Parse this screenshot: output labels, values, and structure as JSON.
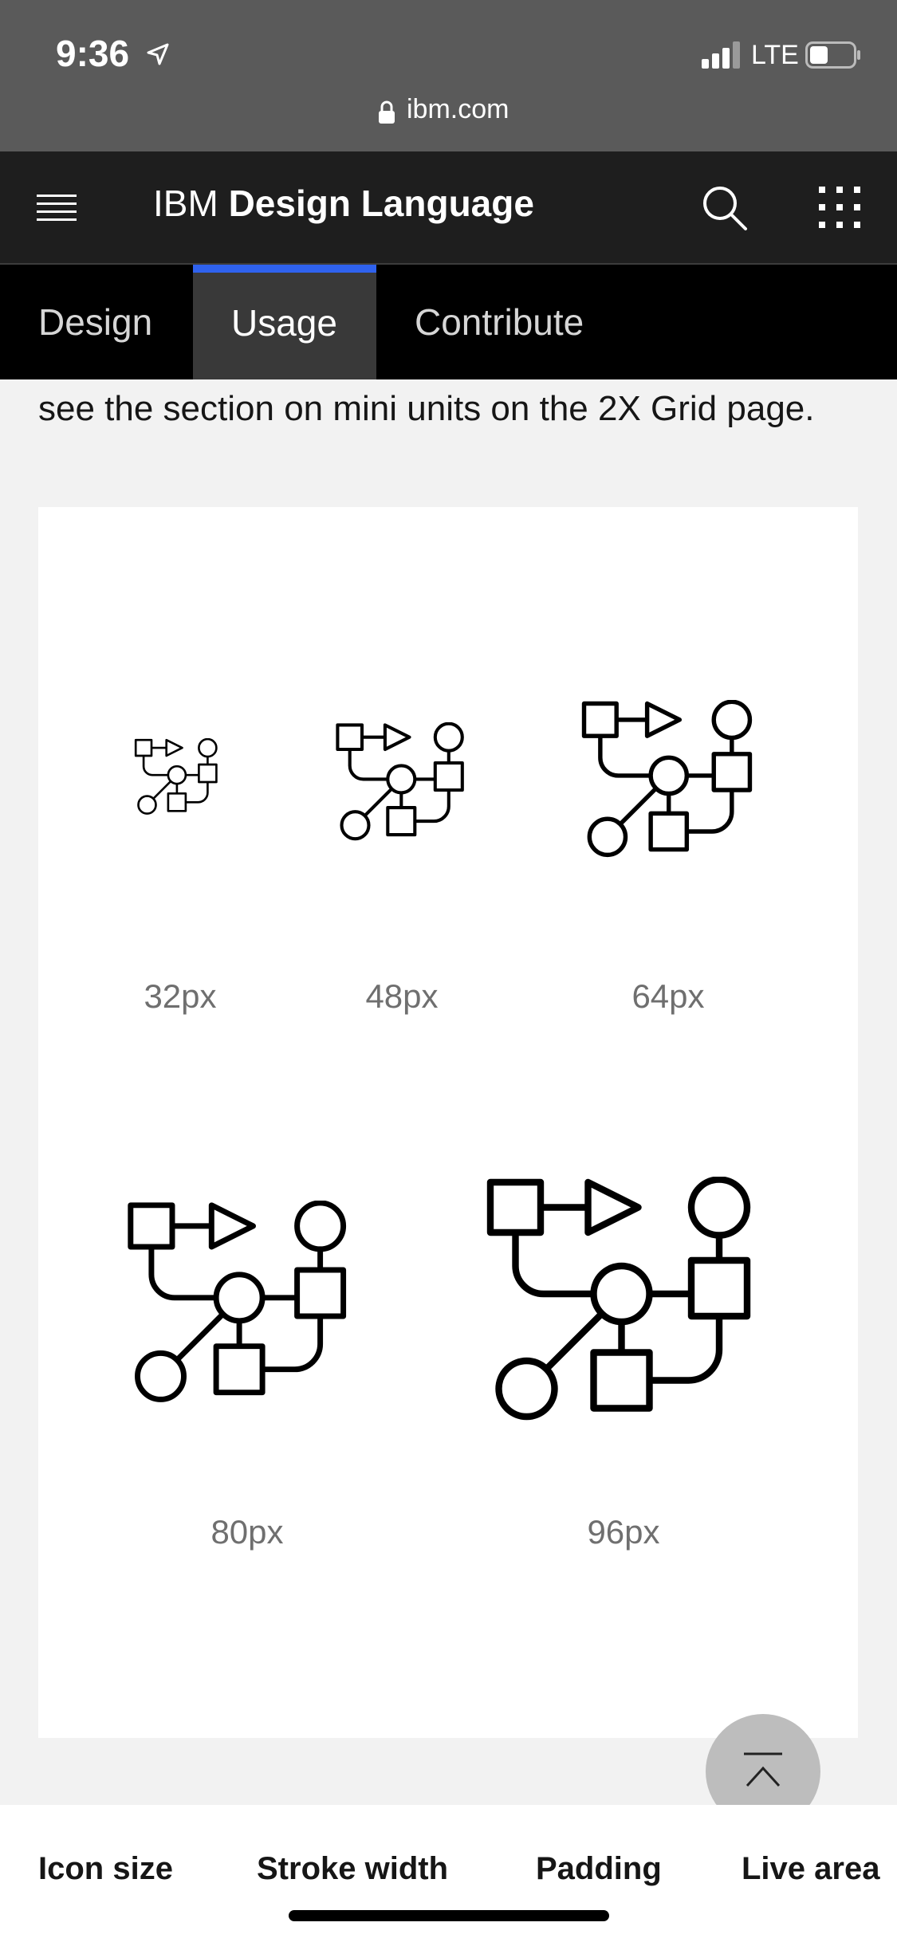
{
  "status": {
    "time": "9:36",
    "carrier": "LTE",
    "url": "ibm.com"
  },
  "header": {
    "brand_prefix": "IBM",
    "brand_name": "Design Language"
  },
  "tabs": [
    {
      "label": "Design",
      "selected": false
    },
    {
      "label": "Usage",
      "selected": true
    },
    {
      "label": "Contribute",
      "selected": false
    }
  ],
  "content": {
    "intro_text": "see the section on mini units on the 2X Grid page.",
    "icon_sizes": [
      {
        "label": "32px"
      },
      {
        "label": "48px"
      },
      {
        "label": "64px"
      },
      {
        "label": "80px"
      },
      {
        "label": "96px"
      }
    ]
  },
  "bottom_nav": {
    "items": [
      "Icon size",
      "Stroke width",
      "Padding",
      "Live area"
    ]
  },
  "colors": {
    "accent": "#2f62ee",
    "nav_bg": "#1e1e1e",
    "tab_bg": "#000000",
    "selected_tab_bg": "#393939"
  }
}
